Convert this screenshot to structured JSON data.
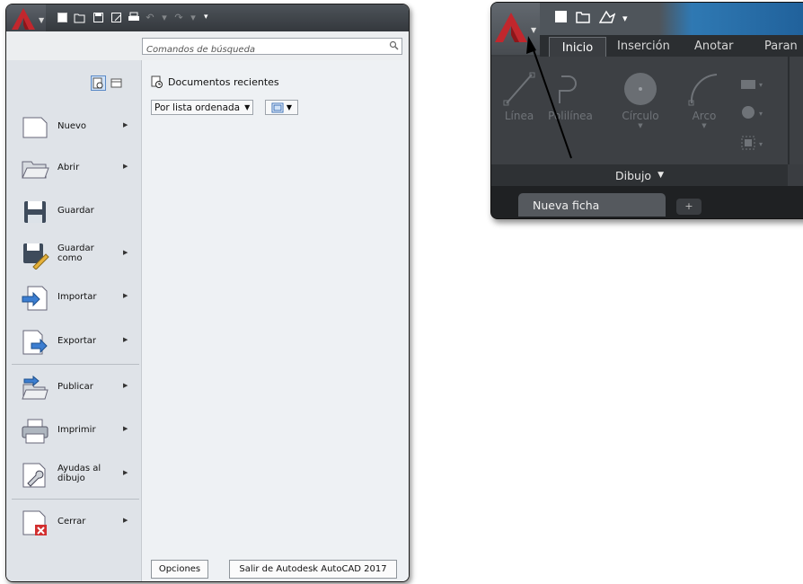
{
  "app_menu": {
    "search": {
      "placeholder": "Comandos de búsqueda",
      "icon": "magnifier-icon"
    },
    "recent": {
      "title": "Documentos recientes",
      "sort_label": "Por lista ordenada"
    },
    "items": [
      {
        "label": "Nuevo",
        "icon": "new-document-icon",
        "submenu": true
      },
      {
        "label": "Abrir",
        "icon": "open-folder-icon",
        "submenu": true
      },
      {
        "label": "Guardar",
        "icon": "save-disk-icon",
        "submenu": false
      },
      {
        "label": "Guardar\ncomo",
        "icon": "save-as-icon",
        "submenu": true
      },
      {
        "label": "Importar",
        "icon": "import-icon",
        "submenu": true
      },
      {
        "label": "Exportar",
        "icon": "export-icon",
        "submenu": true
      },
      {
        "label": "Publicar",
        "icon": "publish-icon",
        "submenu": true
      },
      {
        "label": "Imprimir",
        "icon": "printer-icon",
        "submenu": true
      },
      {
        "label": "Ayudas al\ndibujo",
        "icon": "drawing-utilities-icon",
        "submenu": true
      },
      {
        "label": "Cerrar",
        "icon": "close-document-icon",
        "submenu": true
      }
    ],
    "footer": {
      "options_label": "Opciones",
      "exit_label": "Salir de Autodesk AutoCAD 2017"
    }
  },
  "ribbon": {
    "tabs": [
      "Inicio",
      "Inserción",
      "Anotar",
      "Paran"
    ],
    "tools": [
      "Línea",
      "Polilínea",
      "Círculo",
      "Arco"
    ],
    "panel_title": "Dibujo",
    "doc_tab": "Nueva ficha",
    "new_tab_symbol": "+"
  },
  "colors": {
    "logo_red": "#c1272d",
    "accent_blue": "#2f79b3",
    "selection_blue": "#5a89c6"
  }
}
